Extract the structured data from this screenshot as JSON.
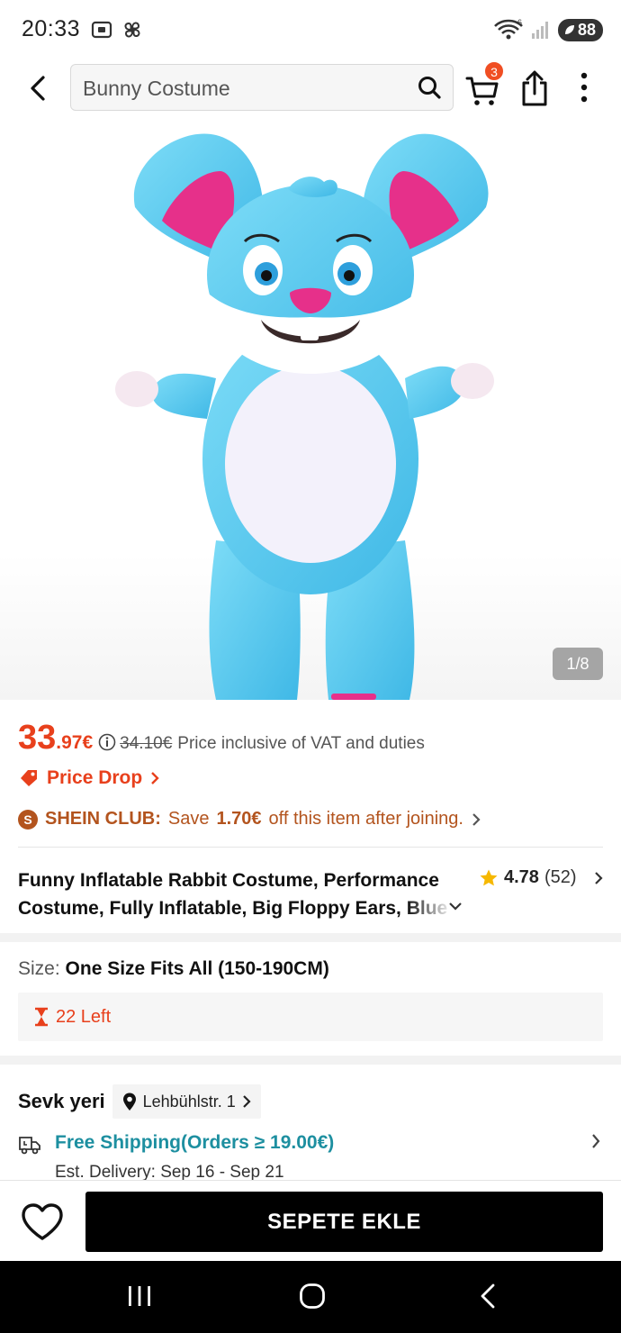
{
  "status_bar": {
    "time": "20:33",
    "wifi_label": "6",
    "battery": "88"
  },
  "search": {
    "query": "Bunny Costume"
  },
  "cart": {
    "count": "3"
  },
  "gallery": {
    "counter": "1/8"
  },
  "price": {
    "main": "33",
    "decimal": ".97€",
    "original": "34.10€",
    "note": "Price inclusive of VAT and duties"
  },
  "price_drop": {
    "label": "Price Drop"
  },
  "club": {
    "badge": "S",
    "name": "SHEIN CLUB:",
    "text_before": "Save",
    "amount": "1.70€",
    "text_after": "off this item after joining."
  },
  "product": {
    "title": "Funny Inflatable Rabbit Costume, Performance Costume, Fully Inflatable, Big Floppy Ears, Blue",
    "rating": "4.78",
    "review_count": "(52)"
  },
  "size": {
    "label": "Size:",
    "value": "One Size Fits All (150-190CM)"
  },
  "stock": {
    "text": "22 Left"
  },
  "shipping": {
    "from_label": "Sevk yeri",
    "location": "Lehbühlstr. 1",
    "free_shipping": "Free Shipping(Orders ≥ 19.00€)",
    "delivery": "Est. Delivery: Sep 16 - Sep 21"
  },
  "actions": {
    "add_to_cart": "SEPETE EKLE"
  },
  "colors": {
    "accent_red": "#e8401c",
    "club_brown": "#b3541e",
    "shipping_teal": "#1d8fa0",
    "bunny_blue": "#5ccff3",
    "bunny_pink": "#e6308a"
  }
}
